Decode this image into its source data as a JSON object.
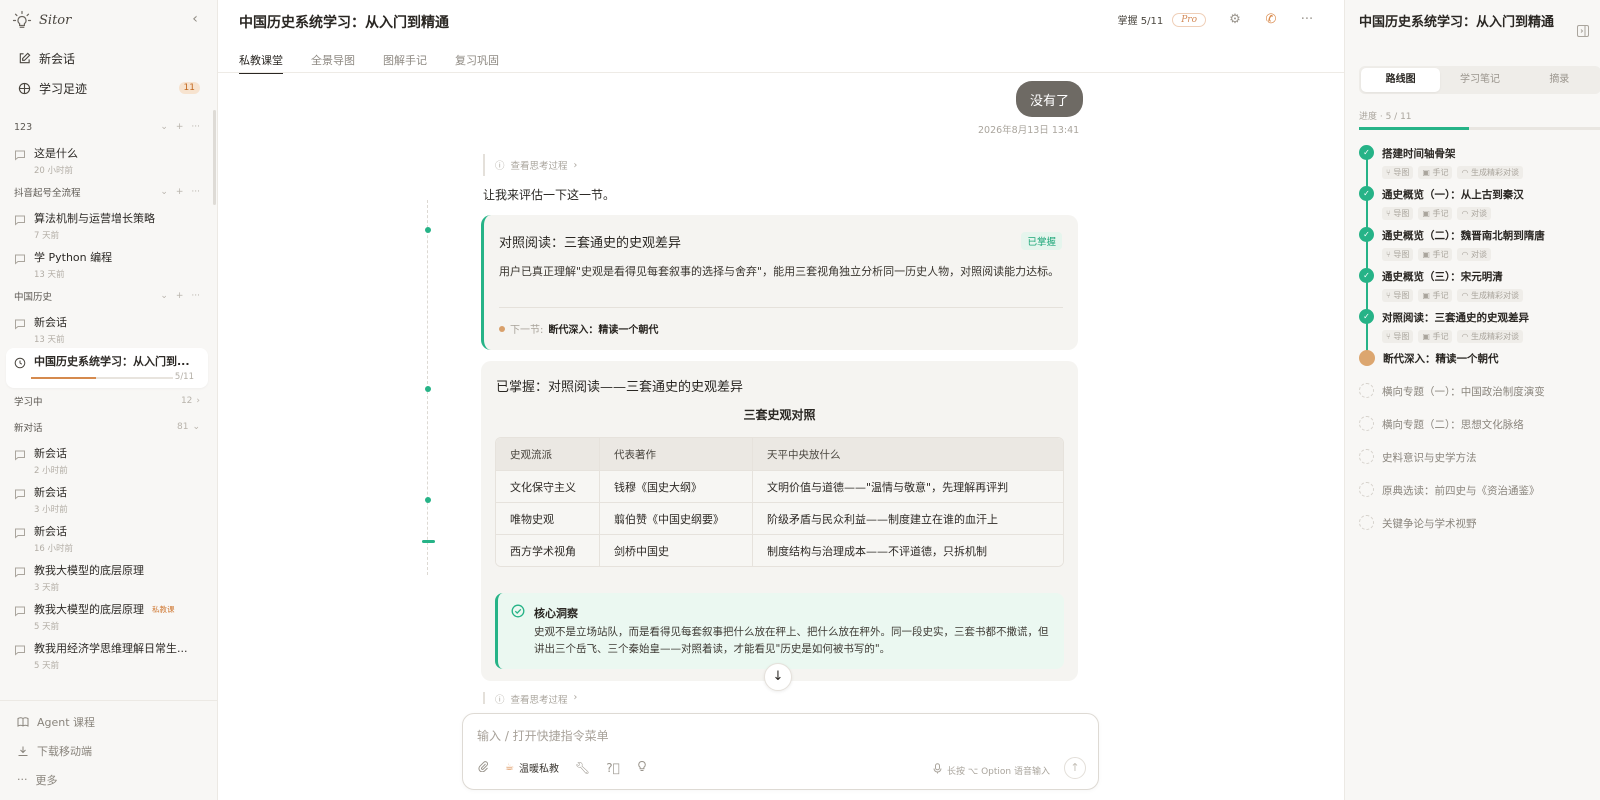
{
  "sidebar": {
    "brand": "Sitor",
    "top_nav": [
      {
        "label": "新会话"
      },
      {
        "label": "学习足迹",
        "badge": "11"
      }
    ],
    "groups": [
      {
        "name": "123",
        "items": [
          {
            "title": "这是什么",
            "time": "20 小时前"
          }
        ]
      },
      {
        "name": "抖音起号全流程",
        "items": [
          {
            "title": "算法机制与运营增长策略",
            "time": "7 天前"
          },
          {
            "title": "学 Python 编程",
            "time": "13 天前"
          }
        ]
      },
      {
        "name": "中国历史",
        "items": [
          {
            "title": "新会话",
            "time": "13 天前"
          },
          {
            "title": "中国历史系统学习：从入门到...",
            "progress_text": "5/11",
            "progress": 0.4545
          }
        ]
      }
    ],
    "learning": {
      "name": "学习中",
      "count": "12"
    },
    "new_chats": {
      "name": "新对话",
      "count": "81",
      "items": [
        {
          "title": "新会话",
          "time": "2 小时前"
        },
        {
          "title": "新会话",
          "time": "3 小时前"
        },
        {
          "title": "新会话",
          "time": "16 小时前"
        },
        {
          "title": "教我大模型的底层原理",
          "time": "3 天前"
        },
        {
          "title": "教我大模型的底层原理",
          "tag": "私教课",
          "time": "5 天前"
        },
        {
          "title": "教我用经济学思维理解日常生...",
          "time": "5 天前"
        }
      ]
    },
    "bottom_nav": [
      {
        "label": "Agent 课程"
      },
      {
        "label": "下载移动端"
      },
      {
        "label": "更多"
      }
    ]
  },
  "header": {
    "title": "中国历史系统学习：从入门到精通",
    "mastery": "掌握 5/11",
    "plan": "Pro"
  },
  "tabs": [
    "私教课堂",
    "全景导图",
    "图解手记",
    "复习巩固"
  ],
  "chat": {
    "user_message": "没有了",
    "user_time": "2026年8月13日 13:41",
    "thinking_label": "查看思考过程",
    "assistant_lead": "让我来评估一下这一节。",
    "eval_card": {
      "title": "对照阅读：三套通史的史观差异",
      "badge": "已掌握",
      "body": "用户已真正理解\"史观是看得见每套叙事的选择与舍弃\"，能用三套视角独立分析同一历史人物，对照阅读能力达标。",
      "next_label": "下一节:",
      "next_value": "断代深入：精读一个朝代"
    },
    "summary_card": {
      "title": "已掌握：对照阅读——三套通史的史观差异",
      "table_caption": "三套史观对照",
      "columns": [
        "史观流派",
        "代表著作",
        "天平中央放什么"
      ],
      "rows": [
        [
          "文化保守主义",
          "钱穆《国史大纲》",
          "文明价值与道德——\"温情与敬意\"，先理解再评判"
        ],
        [
          "唯物史观",
          "翦伯赞《中国史纲要》",
          "阶级矛盾与民众利益——制度建立在谁的血汗上"
        ],
        [
          "西方学术视角",
          "剑桥中国史",
          "制度结构与治理成本——不评道德，只拆机制"
        ]
      ],
      "insight_title": "核心洞察",
      "insight_body": "史观不是立场站队，而是看得见每套叙事把什么放在秤上、把什么放在秤外。同一段史实，三套书都不撒谎，但讲出三个岳飞、三个秦始皇——对照着读，才能看见\"历史是如何被书写的\"。"
    }
  },
  "composer": {
    "placeholder": "输入 / 打开快捷指令菜单",
    "tutor_label": "温暖私教",
    "voice_hint": "长按 ⌥ Option 语音输入"
  },
  "right_panel": {
    "title": "中国历史系统学习：从入门到精通",
    "tabs": [
      "路线图",
      "学习笔记",
      "摘录"
    ],
    "progress_label": "进度 · 5 / 11",
    "progress": 0.4545,
    "steps": [
      {
        "title": "搭建时间轴骨架",
        "status": "done",
        "chips": [
          "⑂ 导图",
          "▣ 手记",
          "◠ 生成精彩对谈"
        ]
      },
      {
        "title": "通史概览（一）：从上古到秦汉",
        "status": "done",
        "chips": [
          "⑂ 导图",
          "▣ 手记",
          "◠ 对谈"
        ]
      },
      {
        "title": "通史概览（二）：魏晋南北朝到隋唐",
        "status": "done",
        "chips": [
          "⑂ 导图",
          "▣ 手记",
          "◠ 对谈"
        ]
      },
      {
        "title": "通史概览（三）：宋元明清",
        "status": "done",
        "chips": [
          "⑂ 导图",
          "▣ 手记",
          "◠ 生成精彩对谈"
        ]
      },
      {
        "title": "对照阅读：三套通史的史观差异",
        "status": "done",
        "chips": [
          "⑂ 导图",
          "▣ 手记",
          "◠ 生成精彩对谈"
        ]
      },
      {
        "title": "断代深入：精读一个朝代",
        "status": "current",
        "chips": []
      },
      {
        "title": "横向专题（一）：中国政治制度演变",
        "status": "todo",
        "chips": []
      },
      {
        "title": "横向专题（二）：思想文化脉络",
        "status": "todo",
        "chips": []
      },
      {
        "title": "史料意识与史学方法",
        "status": "todo",
        "chips": []
      },
      {
        "title": "原典选读：前四史与《资治通鉴》",
        "status": "todo",
        "chips": []
      },
      {
        "title": "关键争论与学术视野",
        "status": "todo",
        "chips": []
      }
    ]
  },
  "colors": {
    "accent_green": "#26b387",
    "accent_orange": "#d9894a",
    "user_bubble": "#6e6a64"
  }
}
